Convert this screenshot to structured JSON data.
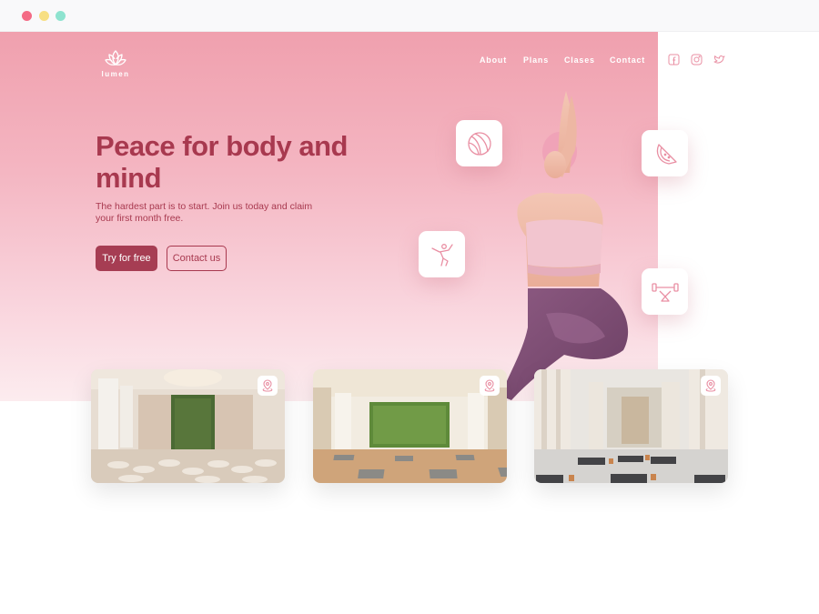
{
  "window": {
    "dots": [
      "red",
      "yellow",
      "green"
    ]
  },
  "brand": {
    "name": "lumen",
    "logo_icon": "lotus-icon"
  },
  "nav": {
    "items": [
      "About",
      "Plans",
      "Clases",
      "Contact"
    ]
  },
  "social": [
    "facebook-icon",
    "instagram-icon",
    "twitter-icon"
  ],
  "hero": {
    "title": "Peace for body and mind",
    "subtitle": "The hardest part is to start. Join us today and claim your first month free.",
    "primary_cta": "Try for free",
    "secondary_cta": "Contact us"
  },
  "feature_icons": [
    "ball-icon",
    "yoga-pose-icon",
    "watermelon-icon",
    "weights-icon"
  ],
  "studios": [
    {
      "icon": "location-pin-icon"
    },
    {
      "icon": "location-pin-icon"
    },
    {
      "icon": "location-pin-icon"
    }
  ],
  "colors": {
    "accent": "#a63d53",
    "hero_top": "#f0a0ae",
    "hero_bottom": "#fcecef",
    "icon_stroke": "#e98fa3"
  }
}
